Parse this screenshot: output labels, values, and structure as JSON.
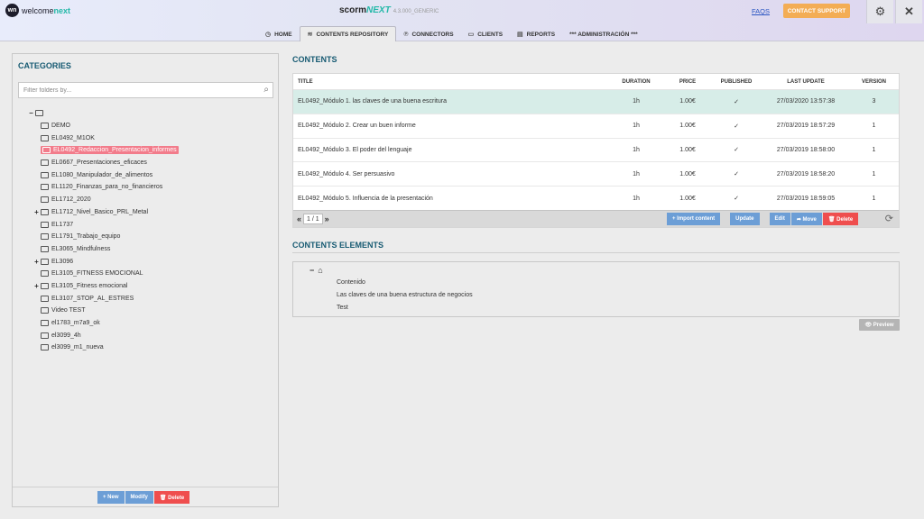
{
  "header": {
    "logo": {
      "mark": "wn",
      "word": "welcome",
      "word_accent": "next"
    },
    "app_title": {
      "name": "scorm",
      "name_accent": "NEXT",
      "version": "4.3.000_GENERIC"
    },
    "faqs": "FAQS",
    "contact": "CONTACT SUPPORT",
    "gear_icon": "⚙",
    "close_icon": "✕"
  },
  "tabs": [
    {
      "label": "HOME",
      "icon": "◷"
    },
    {
      "label": "CONTENTS REPOSITORY",
      "icon": "≋"
    },
    {
      "label": "CONNECTORS",
      "icon": "℗"
    },
    {
      "label": "CLIENTS",
      "icon": "▭"
    },
    {
      "label": "REPORTS",
      "icon": "▤"
    },
    {
      "label": "*** ADMINISTRACIÓN ***",
      "icon": ""
    }
  ],
  "categories": {
    "title": "CATEGORIES",
    "filter_placeholder": "Filter folders by...",
    "root_expander": "−",
    "items": [
      {
        "label": "DEMO",
        "expander": ""
      },
      {
        "label": "EL0492_M1OK",
        "expander": ""
      },
      {
        "label": "EL0492_Redaccion_Presentacion_informes",
        "expander": ""
      },
      {
        "label": "EL0667_Presentaciones_eficaces",
        "expander": ""
      },
      {
        "label": "EL1080_Manipulador_de_alimentos",
        "expander": ""
      },
      {
        "label": "EL1120_Finanzas_para_no_financieros",
        "expander": ""
      },
      {
        "label": "EL1712_2020",
        "expander": ""
      },
      {
        "label": "EL1712_Nivel_Basico_PRL_Metal",
        "expander": "+"
      },
      {
        "label": "EL1737",
        "expander": ""
      },
      {
        "label": "EL1791_Trabajo_equipo",
        "expander": ""
      },
      {
        "label": "EL3065_Mindfulness",
        "expander": ""
      },
      {
        "label": "EL3096",
        "expander": "+"
      },
      {
        "label": "EL3105_FITNESS EMOCIONAL",
        "expander": ""
      },
      {
        "label": "EL3105_Fitness emocional",
        "expander": "+"
      },
      {
        "label": "EL3107_STOP_AL_ESTRES",
        "expander": ""
      },
      {
        "label": "Video TEST",
        "expander": ""
      },
      {
        "label": "el1783_m7a9_ok",
        "expander": ""
      },
      {
        "label": "el3099_4h",
        "expander": ""
      },
      {
        "label": "el3099_m1_nueva",
        "expander": ""
      }
    ],
    "buttons": {
      "new": "+ New",
      "modify": "Modify",
      "delete": "🗑 Delete"
    }
  },
  "contents": {
    "title": "CONTENTS",
    "columns": {
      "title": "TITLE",
      "duration": "DURATION",
      "price": "PRICE",
      "published": "PUBLISHED",
      "last_update": "LAST UPDATE",
      "version": "VERSION"
    },
    "rows": [
      {
        "title": "EL0492_Módulo 1. las claves de una buena escritura",
        "duration": "1h",
        "price": "1.00€",
        "published": "✓",
        "last_update": "27/03/2020 13:57:38",
        "version": "3"
      },
      {
        "title": "EL0492_Módulo 2. Crear un buen informe",
        "duration": "1h",
        "price": "1.00€",
        "published": "✓",
        "last_update": "27/03/2019 18:57:29",
        "version": "1"
      },
      {
        "title": "EL0492_Módulo 3. El poder del lenguaje",
        "duration": "1h",
        "price": "1.00€",
        "published": "✓",
        "last_update": "27/03/2019 18:58:00",
        "version": "1"
      },
      {
        "title": "EL0492_Módulo 4. Ser persuasivo",
        "duration": "1h",
        "price": "1.00€",
        "published": "✓",
        "last_update": "27/03/2019 18:58:20",
        "version": "1"
      },
      {
        "title": "EL0492_Módulo 5. Influencia de la presentación",
        "duration": "1h",
        "price": "1.00€",
        "published": "✓",
        "last_update": "27/03/2019 18:59:05",
        "version": "1"
      }
    ],
    "pager": {
      "first": "«",
      "page": "1 / 1",
      "last": "»"
    },
    "buttons": {
      "import": "+ Import content",
      "update": "Update",
      "edit": "Edit",
      "move": "➦ Move",
      "delete": "🗑 Delete"
    },
    "refresh_icon": "⟳"
  },
  "elements": {
    "title": "CONTENTS ELEMENTS",
    "root_expander": "−",
    "home_icon": "⌂",
    "items": [
      "Contenido",
      "Las claves de una buena estructura de negocios",
      "Test"
    ],
    "preview": "👁 Preview"
  }
}
